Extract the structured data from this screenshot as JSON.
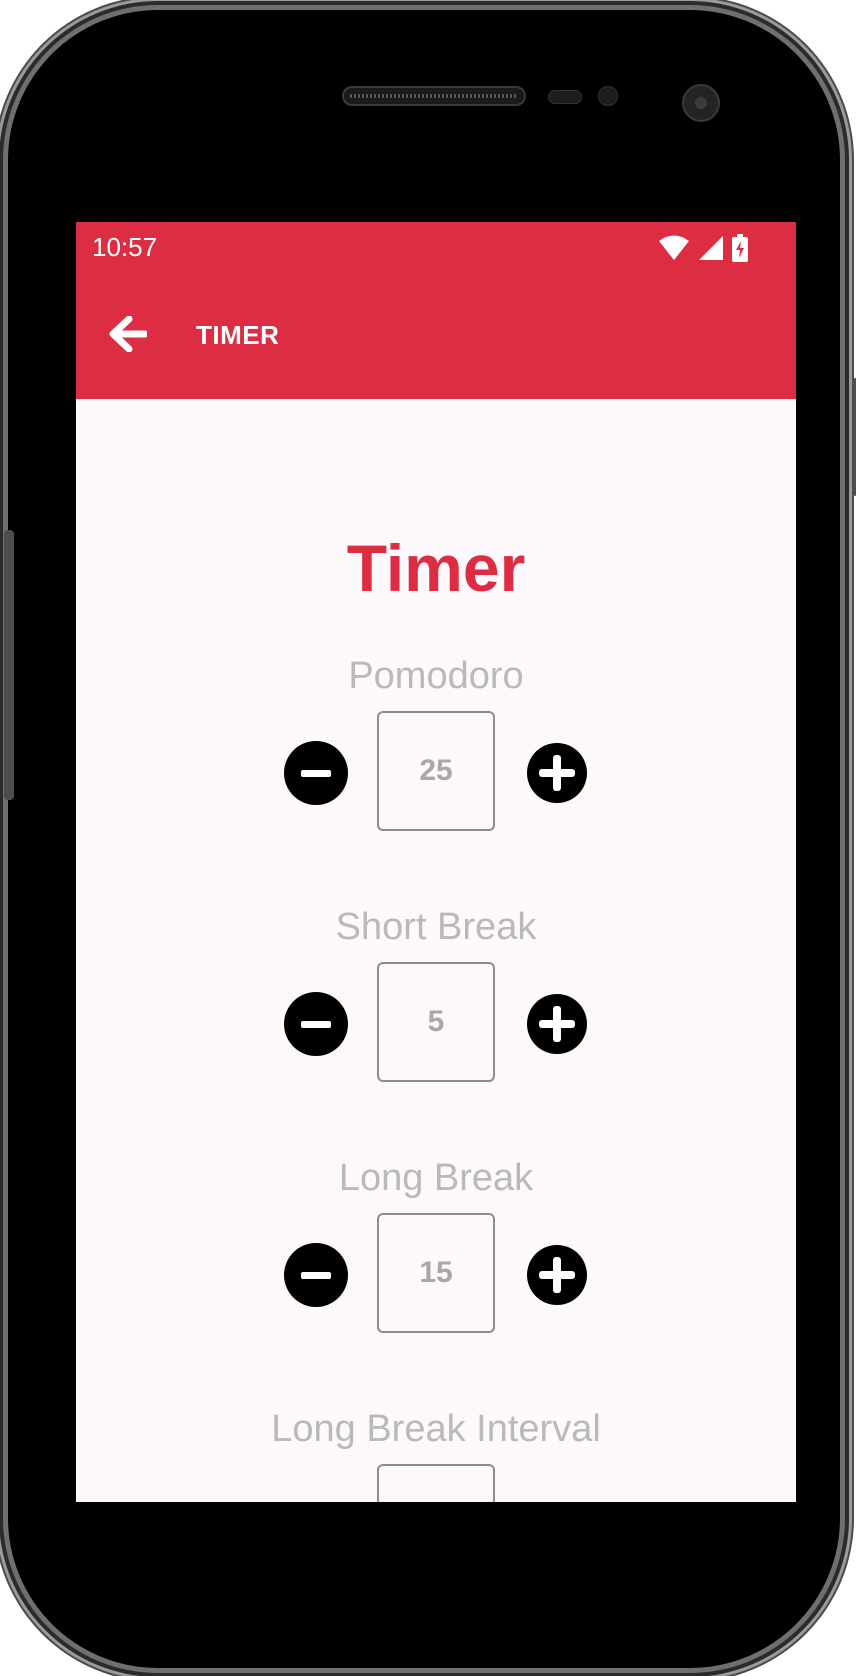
{
  "status_bar": {
    "time": "10:57",
    "icons": [
      "wifi-icon",
      "cellular-signal-icon",
      "battery-charging-icon"
    ]
  },
  "app_bar": {
    "back_icon": "arrow-left-icon",
    "title": "TIMER",
    "background": "#dc2d43"
  },
  "main": {
    "heading": "Timer",
    "settings": [
      {
        "label": "Pomodoro",
        "value": "25"
      },
      {
        "label": "Short Break",
        "value": "5"
      },
      {
        "label": "Long Break",
        "value": "15"
      },
      {
        "label": "Long Break Interval",
        "value": ""
      }
    ],
    "decrement_icon": "minus-circle-icon",
    "increment_icon": "plus-circle-icon"
  },
  "colors": {
    "accent": "#dc2d43",
    "label": "#b9b9b9",
    "value": "#a8a8a8",
    "screen_background": "#fcf8fb"
  }
}
